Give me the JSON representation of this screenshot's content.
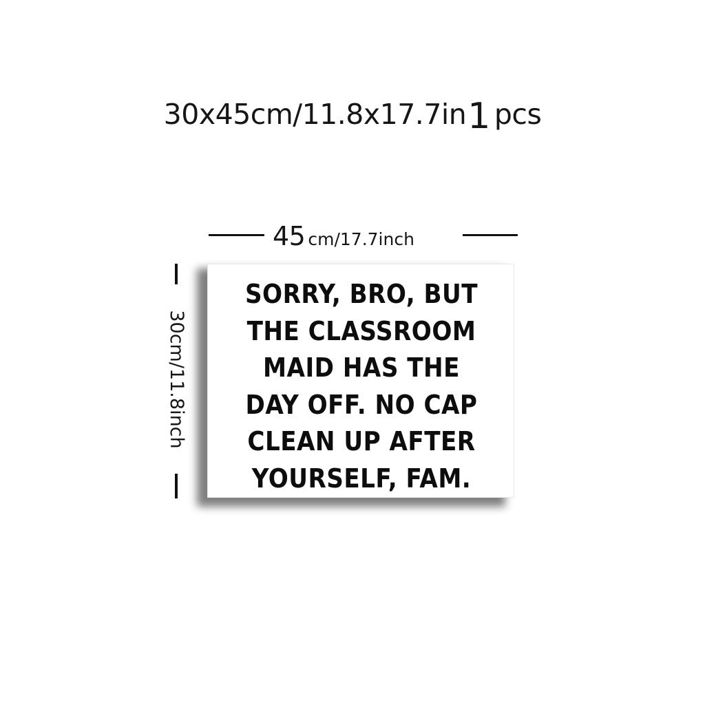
{
  "title": {
    "size_text": "30x45cm/11.8x17.7in",
    "quantity": "1",
    "quantity_unit": "pcs"
  },
  "dimensions": {
    "width_value": "45",
    "width_unit": "cm/17.7inch",
    "height_label": "30cm/11.8inch"
  },
  "sign": {
    "lines": [
      "SORRY, BRO, BUT",
      "THE CLASSROOM",
      "MAID HAS THE",
      "DAY OFF. NO CAP",
      "CLEAN UP AFTER",
      "YOURSELF, FAM."
    ]
  },
  "colors": {
    "background": "#ffffff",
    "text": "#111111",
    "sign_background": "#ffffff"
  }
}
